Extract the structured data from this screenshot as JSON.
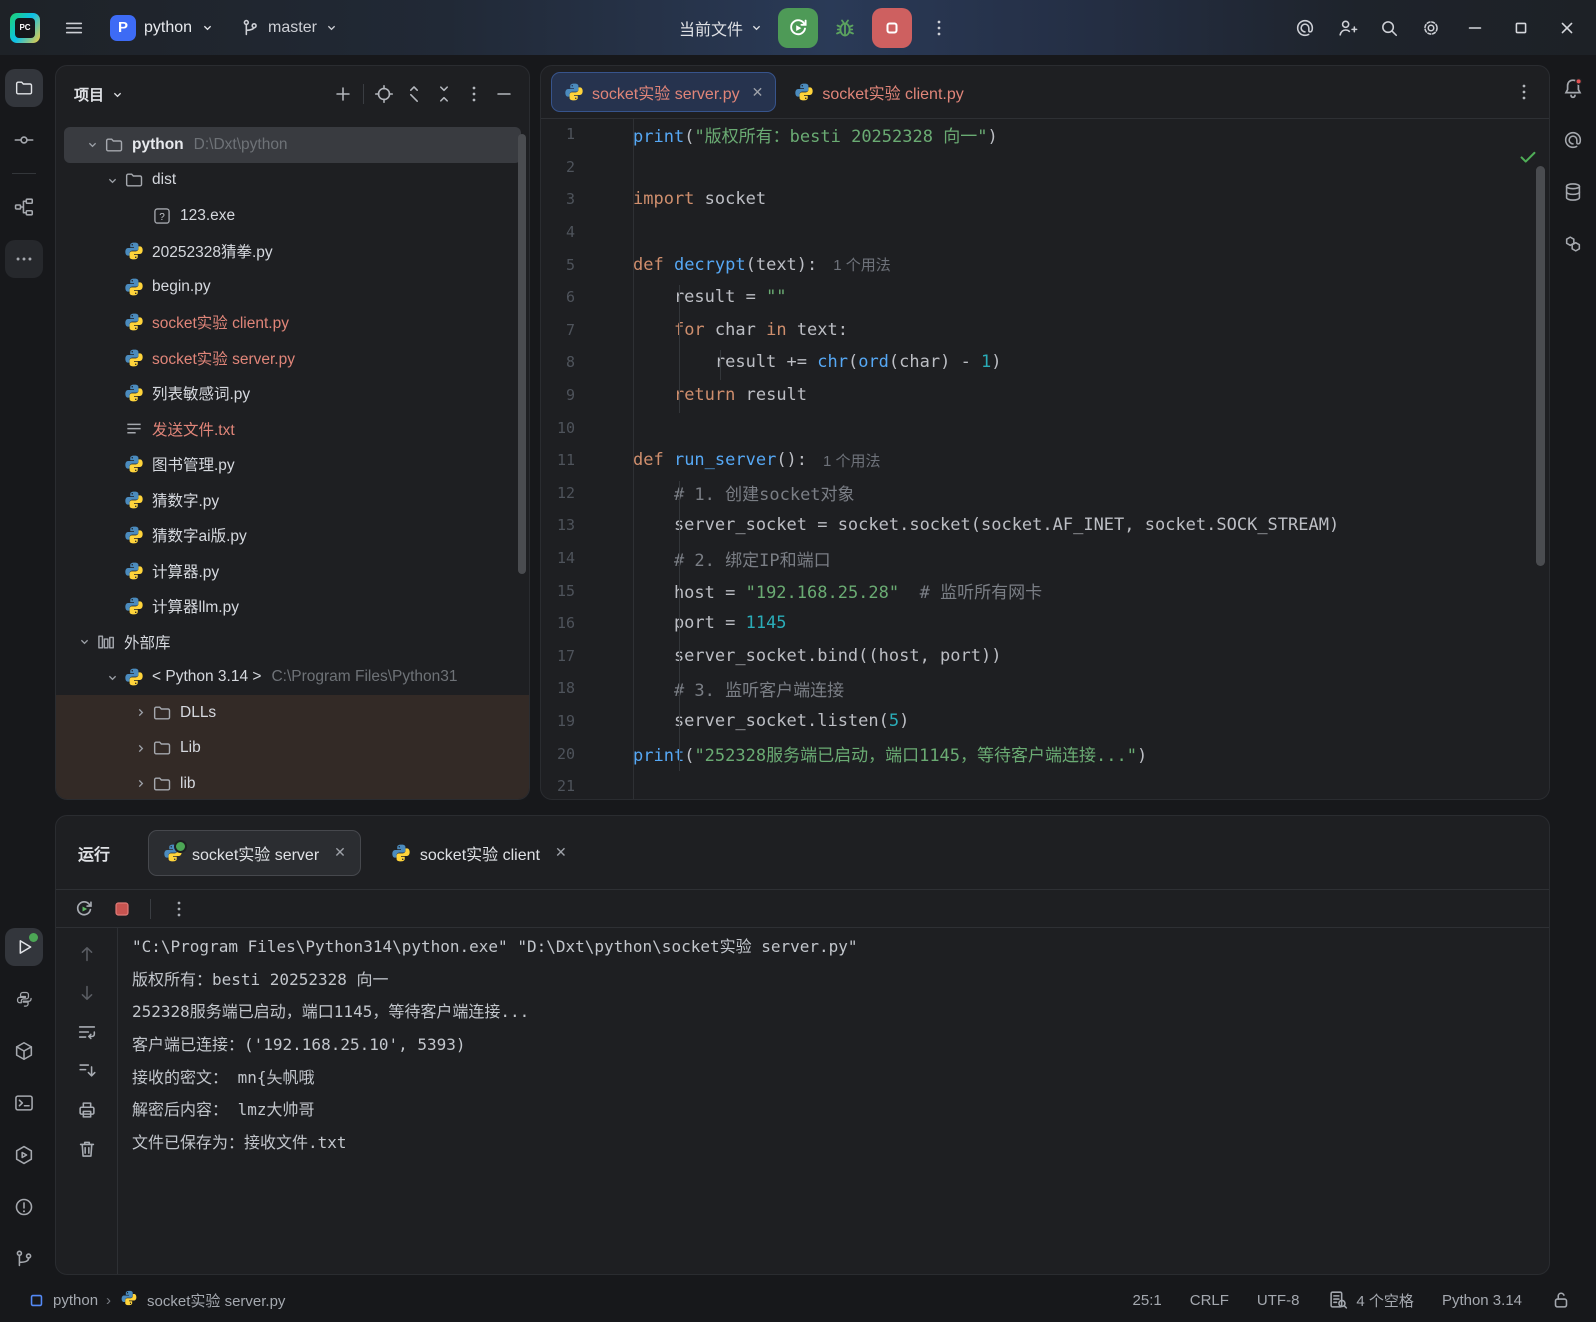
{
  "titlebar": {
    "logo_text": "PC",
    "project": "python",
    "project_initial": "P",
    "branch": "master",
    "run_config": "当前文件"
  },
  "left_strip": {
    "top": [
      {
        "name": "project-tool-icon",
        "icon": "folder",
        "active": true
      },
      {
        "name": "commit-tool-icon",
        "icon": "commit"
      },
      {
        "name": "divider",
        "icon": "divider"
      },
      {
        "name": "structure-tool-icon",
        "icon": "structure"
      },
      {
        "name": "more-tools-icon",
        "icon": "more",
        "subtle": true
      }
    ],
    "bottom": [
      {
        "name": "run-tool-icon",
        "icon": "play",
        "active": true,
        "dot": true
      },
      {
        "name": "python-console-icon",
        "icon": "pyconsole"
      },
      {
        "name": "python-packages-icon",
        "icon": "package"
      },
      {
        "name": "terminal-tool-icon",
        "icon": "terminal"
      },
      {
        "name": "services-tool-icon",
        "icon": "services"
      },
      {
        "name": "problems-tool-icon",
        "icon": "problems"
      },
      {
        "name": "version-control-icon",
        "icon": "gitbranch"
      }
    ]
  },
  "right_strip": [
    {
      "name": "notifications-icon",
      "icon": "bell"
    },
    {
      "name": "ai-assistant-icon",
      "icon": "ai"
    },
    {
      "name": "database-tool-icon",
      "icon": "database"
    },
    {
      "name": "plugins-tool-icon",
      "icon": "hexchain"
    }
  ],
  "project_panel": {
    "title": "项目",
    "tree": [
      {
        "label": "python",
        "path": "D:\\Dxt\\python",
        "icon": "folder",
        "level": 0,
        "chevron": "down",
        "bold": true,
        "selected": true
      },
      {
        "label": "dist",
        "icon": "folder",
        "level": 1,
        "chevron": "down"
      },
      {
        "label": "123.exe",
        "icon": "exe",
        "level": 2
      },
      {
        "label": "20252328猜拳.py",
        "icon": "python",
        "level": 1
      },
      {
        "label": "begin.py",
        "icon": "python",
        "level": 1
      },
      {
        "label": "socket实验 client.py",
        "icon": "python",
        "level": 1,
        "red": true
      },
      {
        "label": "socket实验 server.py",
        "icon": "python",
        "level": 1,
        "red": true
      },
      {
        "label": "列表敏感词.py",
        "icon": "python",
        "level": 1
      },
      {
        "label": "发送文件.txt",
        "icon": "textfile",
        "level": 1,
        "red": true
      },
      {
        "label": "图书管理.py",
        "icon": "python",
        "level": 1
      },
      {
        "label": "猜数字.py",
        "icon": "python",
        "level": 1
      },
      {
        "label": "猜数字ai版.py",
        "icon": "python",
        "level": 1
      },
      {
        "label": "计算器.py",
        "icon": "python",
        "level": 1
      },
      {
        "label": "计算器llm.py",
        "icon": "python",
        "level": 1
      },
      {
        "label": "外部库",
        "icon": "library",
        "level": 0,
        "chevron": "down"
      },
      {
        "label": "< Python 3.14 >",
        "path": "C:\\Program Files\\Python31",
        "icon": "python",
        "level": 1,
        "chevron": "down"
      },
      {
        "label": "DLLs",
        "icon": "folder",
        "level": 2,
        "chevron": "right",
        "band": true
      },
      {
        "label": "Lib",
        "icon": "folder",
        "level": 2,
        "chevron": "right",
        "band": true
      },
      {
        "label": "lib",
        "icon": "folder",
        "level": 2,
        "chevron": "right",
        "band": true
      }
    ]
  },
  "editor": {
    "tabs": [
      {
        "label": "socket实验 server.py",
        "active": true,
        "closable": true
      },
      {
        "label": "socket实验 client.py",
        "active": false,
        "closable": false
      }
    ],
    "lines": [
      {
        "no": "1",
        "tokens": [
          [
            "f",
            "print"
          ],
          [
            "t",
            "("
          ],
          [
            "s",
            "\"版权所有：besti 20252328 向一\""
          ],
          [
            "t",
            ")"
          ]
        ]
      },
      {
        "no": "2",
        "tokens": []
      },
      {
        "no": "3",
        "tokens": [
          [
            "k",
            "import"
          ],
          [
            "t",
            " socket"
          ]
        ]
      },
      {
        "no": "4",
        "tokens": []
      },
      {
        "no": "5",
        "tokens": [
          [
            "k",
            "def "
          ],
          [
            "f",
            "decrypt"
          ],
          [
            "t",
            "(text):"
          ]
        ],
        "inlay": "1 个用法"
      },
      {
        "no": "6",
        "tokens": [
          [
            "t",
            "    result = "
          ],
          [
            "s",
            "\"\""
          ]
        ]
      },
      {
        "no": "7",
        "tokens": [
          [
            "t",
            "    "
          ],
          [
            "k",
            "for"
          ],
          [
            "t",
            " char "
          ],
          [
            "k",
            "in"
          ],
          [
            "t",
            " text:"
          ]
        ]
      },
      {
        "no": "8",
        "tokens": [
          [
            "t",
            "        result += "
          ],
          [
            "f",
            "chr"
          ],
          [
            "t",
            "("
          ],
          [
            "f",
            "ord"
          ],
          [
            "t",
            "(char) - "
          ],
          [
            "n",
            "1"
          ],
          [
            "t",
            ")"
          ]
        ]
      },
      {
        "no": "9",
        "tokens": [
          [
            "t",
            "    "
          ],
          [
            "k",
            "return"
          ],
          [
            "t",
            " result"
          ]
        ]
      },
      {
        "no": "10",
        "tokens": []
      },
      {
        "no": "11",
        "tokens": [
          [
            "k",
            "def "
          ],
          [
            "f",
            "run_server"
          ],
          [
            "t",
            "():"
          ]
        ],
        "inlay": "1 个用法"
      },
      {
        "no": "12",
        "tokens": [
          [
            "t",
            "    "
          ],
          [
            "c",
            "# 1. 创建socket对象"
          ]
        ]
      },
      {
        "no": "13",
        "tokens": [
          [
            "t",
            "    server_socket = socket.socket(socket.AF_INET, socket.SOCK_STREAM)"
          ]
        ]
      },
      {
        "no": "14",
        "tokens": [
          [
            "t",
            "    "
          ],
          [
            "c",
            "# 2. 绑定IP和端口"
          ]
        ]
      },
      {
        "no": "15",
        "tokens": [
          [
            "t",
            "    host = "
          ],
          [
            "s",
            "\"192.168.25.28\""
          ],
          [
            "t",
            "  "
          ],
          [
            "c",
            "# 监听所有网卡"
          ]
        ]
      },
      {
        "no": "16",
        "tokens": [
          [
            "t",
            "    port = "
          ],
          [
            "n",
            "1145"
          ]
        ]
      },
      {
        "no": "17",
        "tokens": [
          [
            "t",
            "    server_socket.bind((host, port))"
          ]
        ]
      },
      {
        "no": "18",
        "tokens": [
          [
            "t",
            "    "
          ],
          [
            "c",
            "# 3. 监听客户端连接"
          ]
        ]
      },
      {
        "no": "19",
        "tokens": [
          [
            "t",
            "    server_socket.listen("
          ],
          [
            "n",
            "5"
          ],
          [
            "t",
            ")"
          ]
        ]
      },
      {
        "no": "20",
        "tokens": [
          [
            "f",
            "print"
          ],
          [
            "t",
            "("
          ],
          [
            "s",
            "\"252328服务端已启动，端口1145，等待客户端连接...\""
          ],
          [
            "t",
            ")"
          ]
        ]
      },
      {
        "no": "21",
        "tokens": []
      }
    ]
  },
  "run_panel": {
    "title": "运行",
    "tabs": [
      {
        "label": "socket实验 server",
        "active": true,
        "running": true
      },
      {
        "label": "socket实验 client",
        "active": false,
        "running": false
      }
    ],
    "console": [
      "\"C:\\Program Files\\Python314\\python.exe\" \"D:\\Dxt\\python\\socket实验 server.py\"",
      "版权所有：besti 20252328 向一",
      "252328服务端已启动，端口1145，等待客户端连接...",
      "客户端已连接：('192.168.25.10', 5393)",
      "接收的密文： mn{夨帆哦",
      "解密后内容： lmz大帅哥",
      "文件已保存为：接收文件.txt"
    ]
  },
  "status_bar": {
    "module": "python",
    "file": "socket实验 server.py",
    "position": "25:1",
    "line_ending": "CRLF",
    "encoding": "UTF-8",
    "indent": "4 个空格",
    "interpreter": "Python 3.14"
  },
  "colors": {
    "run_green": "#4E9A57",
    "stop_red": "#CE6060",
    "unversioned_file": "#E08579",
    "keyword": "#CF8E6D",
    "function": "#56A8F5",
    "string": "#6AAB73",
    "number": "#2AACB8",
    "comment": "#7A7E85",
    "editor_bg": "#1E1F22",
    "tab_active_bg": "#26334E"
  }
}
